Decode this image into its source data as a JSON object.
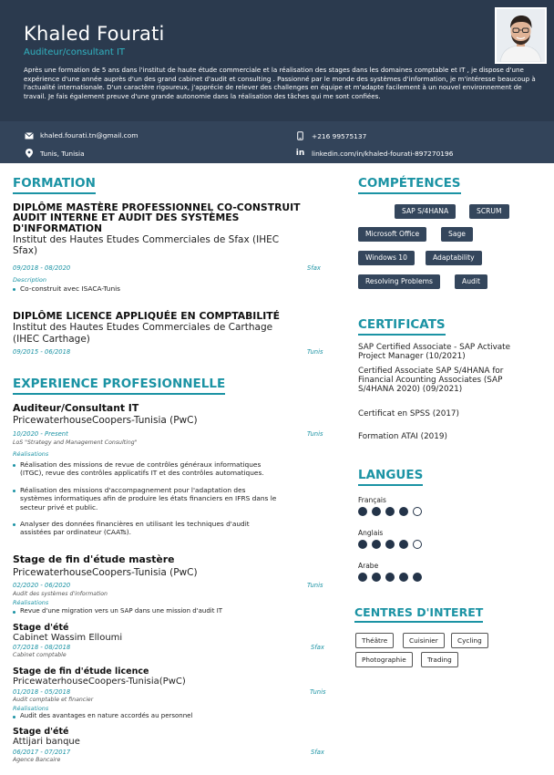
{
  "header": {
    "name": "Khaled Fourati",
    "job_title": "Auditeur/consultant IT",
    "summary": "Après une formation de 5 ans dans l'institut de haute étude commerciale et la réalisation des stages dans les domaines comptable et IT , je dispose d'une expérience d'une année auprès d'un des grand cabinet d'audit et consulting . Passionné par le monde des systèmes d'information, je m'intéresse beaucoup à l'actualité internationale. D'un caractère rigoureux, j'apprécie de relever des challenges en équipe et m'adapte facilement à un nouvel environnement de travail. Je fais également preuve d'une grande autonomie dans la réalisation des tâches qui me sont confiées."
  },
  "contacts": {
    "email": "khaled.fourati.tn@gmail.com",
    "phone": "+216 99575137",
    "location": "Tunis, Tunisia",
    "linkedin": "linkedin.com/in/khaled-fourati-897270196"
  },
  "formation": {
    "title": "FORMATION",
    "items": [
      {
        "degree_l1": "DIPLÔME MASTÈRE PROFESSIONNEL CO-CONSTRUIT",
        "degree_l2": "AUDIT INTERNE ET AUDIT DES SYSTÈMES",
        "degree_l3": "D'INFORMATION",
        "institution_l1": "Institut des Hautes Etudes Commerciales de Sfax (IHEC",
        "institution_l2": "Sfax)",
        "dates": "09/2018 - 08/2020",
        "location": "Sfax",
        "desc_label": "Description",
        "bullet": "Co-construit avec ISACA-Tunis"
      },
      {
        "degree_l1": "DIPLÔME LICENCE APPLIQUÉE EN COMPTABILITÉ",
        "institution_l1": "Institut des Hautes Etudes Commerciales de Carthage",
        "institution_l2": "(IHEC Carthage)",
        "dates": "09/2015 - 06/2018",
        "location": "Tunis"
      }
    ]
  },
  "experience": {
    "title": "EXPERIENCE PROFESIONNELLE",
    "items": [
      {
        "role": "Auditeur/Consultant IT",
        "company": "PricewaterhouseCoopers-Tunisia (PwC)",
        "dates": "10/2020 - Present",
        "location": "Tunis",
        "subtitle": "LoS \"Strategy and Management Consulting\"",
        "label": "Réalisations",
        "b1_l1": "Réalisation des missions de revue de contrôles généraux informatiques",
        "b1_l2": "(ITGC), revue des contrôles applicatifs IT et des contrôles automatiques.",
        "b2_l1": "Réalisation des missions d'accompagnement pour l'adaptation des",
        "b2_l2": "systèmes informatiques afin de produire les états financiers en IFRS dans le",
        "b2_l3": "secteur privé et public.",
        "b3_l1": "Analyser des données financières en utilisant les techniques d'audit",
        "b3_l2": "assistées par ordinateur (CAATs)."
      },
      {
        "role": "Stage de fin d'étude mastère",
        "company": "PricewaterhouseCoopers-Tunisia (PwC)",
        "dates": "02/2020 - 06/2020",
        "location": "Tunis",
        "subtitle": "Audit des systèmes d'information",
        "label": "Réalisations",
        "b1_l1": "Revue d'une migration vers un SAP dans une mission d'audit IT"
      },
      {
        "role": "Stage d'été",
        "company": "Cabinet Wassim Elloumi",
        "dates": "07/2018 - 08/2018",
        "location": "Sfax",
        "subtitle": "Cabinet comptable"
      },
      {
        "role": "Stage de fin d'étude licence",
        "company": "PricewaterhouseCoopers-Tunisia(PwC)",
        "dates": "01/2018 - 05/2018",
        "location": "Tunis",
        "subtitle": "Audit comptable et financier",
        "label": "Réalisations",
        "b1_l1": "Audit des avantages en nature accordés au personnel"
      },
      {
        "role": "Stage d'été",
        "company": "Attijari banque",
        "dates": "06/2017 - 07/2017",
        "location": "Sfax",
        "subtitle": "Agence Bancaire"
      }
    ]
  },
  "competences": {
    "title": "COMPÉTENCES",
    "tags": [
      "SAP S/4HANA",
      "SCRUM",
      "Microsoft Office",
      "Sage",
      "Windows 10",
      "Adaptability",
      "Resolving Problems",
      "Audit"
    ]
  },
  "certificats": {
    "title": "CERTIFICATS",
    "c1_l1": "SAP Certified Associate - SAP Activate",
    "c1_l2": "Project Manager (10/2021)",
    "c2_l1": "Certified Associate SAP S/4HANA for",
    "c2_l2": "Financial Acounting Associates (SAP",
    "c2_l3": "S/4HANA 2020) (09/2021)",
    "c3": "Certificat en SPSS (2017)",
    "c4": "Formation ATAI (2019)"
  },
  "langues": {
    "title": "LANGUES",
    "items": [
      {
        "name": "Français",
        "level": 4,
        "max": 5
      },
      {
        "name": "Anglais",
        "level": 4,
        "max": 5
      },
      {
        "name": "Arabe",
        "level": 5,
        "max": 5
      }
    ]
  },
  "interets": {
    "title": "CENTRES D'INTERET",
    "items": [
      "Théâtre",
      "Cuisinier",
      "Cycling",
      "Photographie",
      "Trading"
    ]
  },
  "colors": {
    "accent": "#1b93a4",
    "header_bg": "#2b3a4e",
    "tag_bg": "#34465c"
  }
}
